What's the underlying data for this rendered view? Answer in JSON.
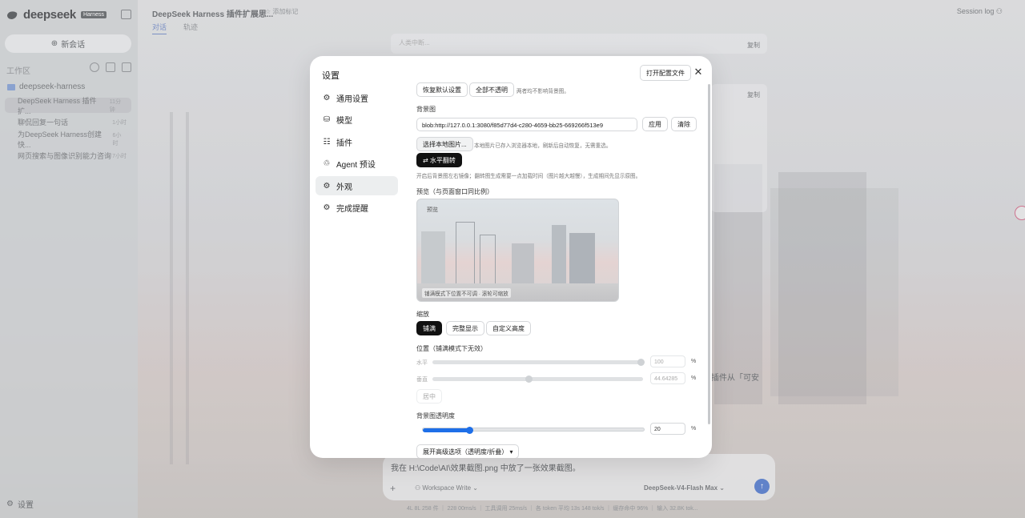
{
  "app": {
    "brand": "deepseek",
    "brand_badge": "Harness",
    "new_chat": "新会话",
    "workspace_label": "工作区",
    "folder": "deepseek-harness",
    "chats": [
      {
        "title": "DeepSeek Harness 插件扩...",
        "time": "11分钟"
      },
      {
        "title": "聊侃回复一句话",
        "time": "1小时"
      },
      {
        "title": "为DeepSeek Harness创建快...",
        "time": "6小时"
      },
      {
        "title": "网页搜索与图像识别能力咨询",
        "time": "7小时"
      }
    ],
    "settings_foot": "设置",
    "top_title": "DeepSeek Harness 插件扩展思...",
    "top_tag": "☆ 添加标记",
    "tab_chat": "对话",
    "tab_trace": "轨迹",
    "session_log": "Session log",
    "copy": "复制",
    "input_hint": "人类中断...",
    "side_text": "插件从「可安",
    "composer_text": "我在 H:\\Code\\AI\\效果截图.png 中放了一张效果截图。",
    "composer_mode": "Workspace Write",
    "composer_model": "DeepSeek-V4-Flash Max",
    "status_bar": "4L 8L 258 件 ｜ 228 00ms/s ｜ 工具调用 25ms/s ｜ 各 token 平均 13s 148 tok/s ｜ 缓存命中 96% ｜ 输入 32.8K tok..."
  },
  "settings": {
    "title": "设置",
    "open_config": "打开配置文件",
    "close": "✕",
    "nav": [
      {
        "icon": "⚙",
        "label": "通用设置"
      },
      {
        "icon": "⛁",
        "label": "模型"
      },
      {
        "icon": "☷",
        "label": "插件"
      },
      {
        "icon": "♲",
        "label": "Agent 预设"
      },
      {
        "icon": "⚙",
        "label": "外观"
      },
      {
        "icon": "⚙",
        "label": "完成提醒"
      }
    ],
    "active_nav": 4,
    "reset_default": "恢复默认设置",
    "all_opaque": "全部不透明",
    "both_hint": "两者均不影响背景图。",
    "bg_label": "背景图",
    "bg_url": "blob:http://127.0.0.1:3080/f85d77d4-c280-4659-bb25-669266f513e9",
    "apply": "应用",
    "clear": "清除",
    "choose_local": "选择本地图片...",
    "local_hint": "本地图片已存入浏览器本地，刷新后自动恢复，无需重选。",
    "flip": "⇄ 水平翻转",
    "flip_hint": "开启后背景图左右镜像；翻转图生成需要一点加载时间（图片越大越慢），生成期间先显示原图。",
    "preview_label": "预览（与页面窗口同比例）",
    "preview_tag": "预览",
    "preview_bottom": "铺满模式下位置不可调 · 滚轮可缩放",
    "scale_label": "缩放",
    "scale_options": [
      "铺满",
      "完整显示",
      "自定义高度"
    ],
    "scale_active": 0,
    "position_label": "位置（铺满模式下无效）",
    "horizontal": "水平",
    "horizontal_value": "100",
    "vertical": "垂直",
    "vertical_value": "44.64285",
    "center": "居中",
    "pct": "%",
    "opacity_label": "背景图透明度",
    "opacity_value": "20",
    "advanced": "展开高级选项（透明度/折叠）",
    "colors": {
      "accent": "#1e6fe8",
      "dark": "#111111"
    }
  }
}
